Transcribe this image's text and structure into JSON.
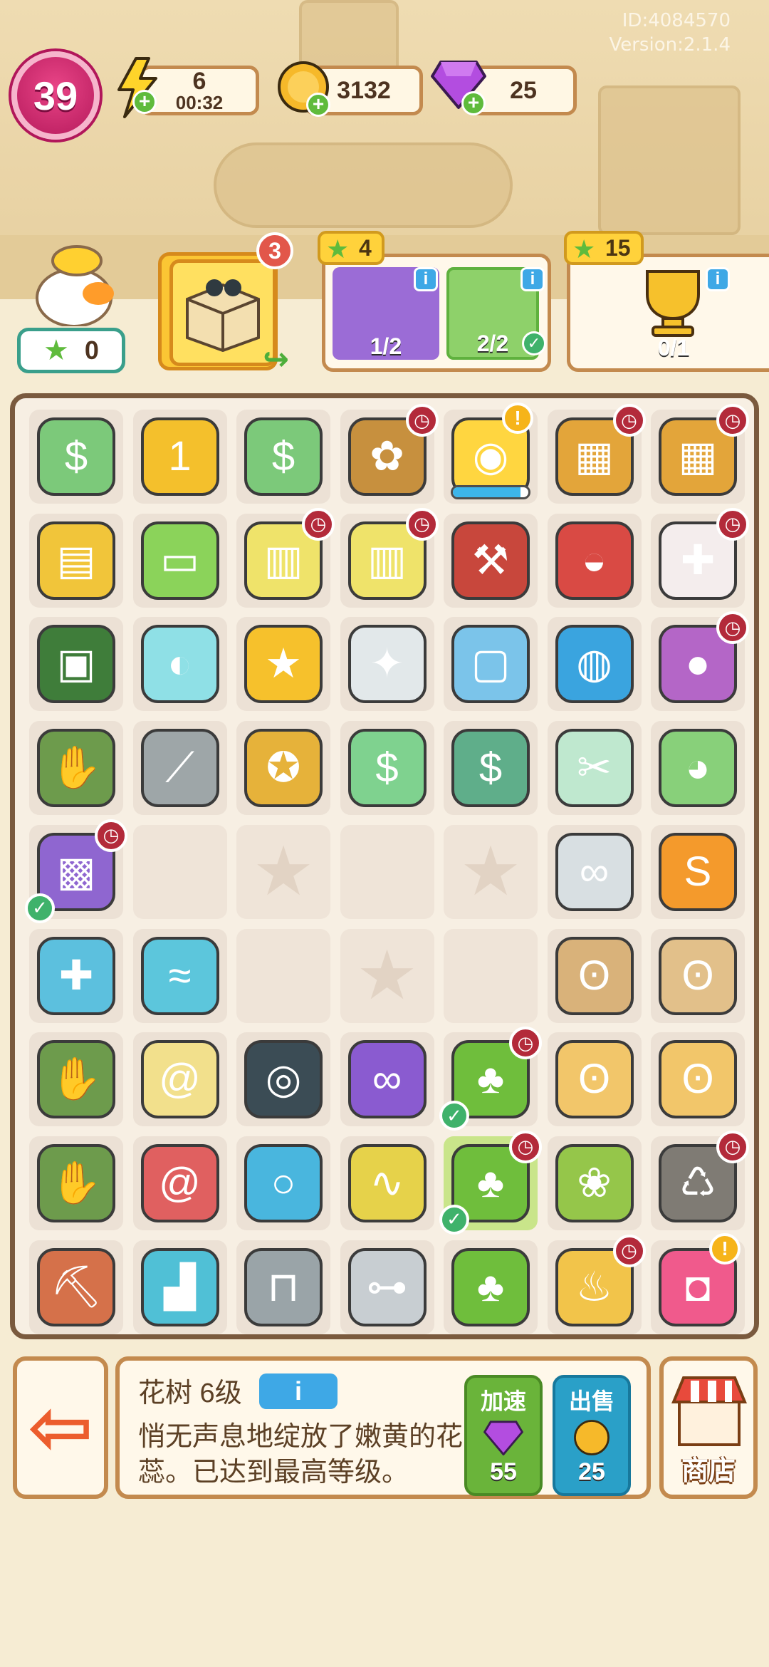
{
  "header": {
    "id_text": "ID:4084570",
    "version_text": "Version:2.1.4",
    "level": "39",
    "energy": {
      "value": "6",
      "timer": "00:32",
      "icon": "lightning-icon"
    },
    "coins": {
      "value": "3132",
      "icon": "coin-icon"
    },
    "gems": {
      "value": "25",
      "icon": "gem-icon"
    },
    "plus": "+"
  },
  "quests": {
    "mascot_stars": "0",
    "inbox_count": "3",
    "order1": {
      "reward": "4",
      "progress_a": "1/2",
      "progress_b": "2/2"
    },
    "order2": {
      "reward": "15",
      "progress": "0/1"
    },
    "info_glyph": "i"
  },
  "board": {
    "rows": [
      [
        "cash-stack",
        "medal-1",
        "cash-stack",
        "flower-basket",
        "duck-float",
        "cabinet",
        "cabinet"
      ],
      [
        "shopping-basket",
        "laptop",
        "dumbbell-cart",
        "dumbbell-cart",
        "wheelbarrow",
        "tool-bucket",
        "first-aid-box"
      ],
      [
        "toolbox",
        "helmet",
        "gold-medal",
        "silver-ribbon",
        "robot-vacuum-station",
        "robot-vacuum",
        "punching-bag"
      ],
      [
        "work-glove",
        "hand-saw",
        "gold-ribbon",
        "banknote",
        "banknotes",
        "hair-clipper",
        "ball-machine"
      ],
      [
        "junk-box",
        "empty",
        "star",
        "empty",
        "star",
        "glasses",
        "basketball-jersey"
      ],
      [
        "puzzle-piece",
        "cloth",
        "empty",
        "star",
        "empty",
        "hamsters",
        "hamster-family"
      ],
      [
        "work-glove",
        "snail",
        "weight-plates",
        "goggles",
        "flower-tree",
        "hamster",
        "hamster"
      ],
      [
        "work-glove",
        "snail-red",
        "hoop",
        "jump-rope",
        "flower-tree",
        "seed-packet",
        "garbage-bag"
      ],
      [
        "pickaxe",
        "stepper",
        "push-up-bar",
        "dumbbells",
        "potted-tree",
        "sprout-cup",
        "backpack"
      ]
    ],
    "duck_float_progress": 0.9
  },
  "footer": {
    "item_title": "花树 6级",
    "info_label": "i",
    "description": "悄无声息地绽放了嫩黄的花蕊。已达到最高等级。",
    "speed_label": "加速",
    "speed_cost": "55",
    "sell_label": "出售",
    "sell_price": "25",
    "shop_label": "商店",
    "exit_glyph": "⇦"
  },
  "colors": {
    "accent_green": "#5fbb3c",
    "accent_blue": "#3ea8e6",
    "level_pink": "#c7236a",
    "border_brown": "#c38a4e"
  }
}
